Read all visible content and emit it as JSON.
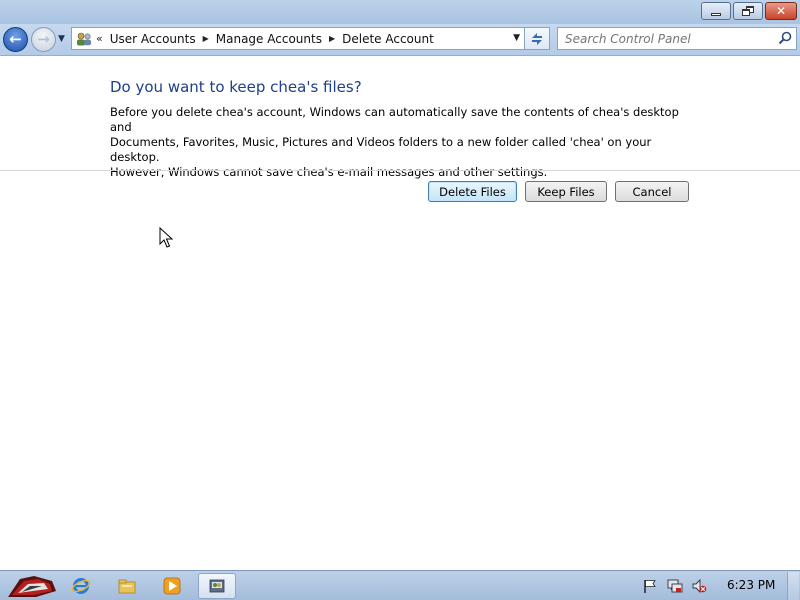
{
  "window": {
    "controls": {
      "minimize_icon": "minimize-icon",
      "maximize_icon": "restore-icon",
      "close_icon": "close-icon"
    }
  },
  "navigation": {
    "back_icon": "back-arrow-icon",
    "forward_icon": "forward-arrow-icon",
    "address_lead": "«",
    "breadcrumbs": [
      {
        "label": "User Accounts"
      },
      {
        "label": "Manage Accounts"
      },
      {
        "label": "Delete Account"
      }
    ],
    "search_placeholder": "Search Control Panel"
  },
  "main": {
    "heading": "Do you want to keep chea's files?",
    "description_lines": [
      "Before you delete chea's account, Windows can automatically save the contents of chea's desktop and",
      "Documents, Favorites, Music, Pictures and Videos folders to a new folder called 'chea' on your desktop.",
      "However, Windows cannot save chea's e-mail messages and other settings."
    ],
    "buttons": {
      "delete_files": "Delete Files",
      "keep_files": "Keep Files",
      "cancel": "Cancel"
    }
  },
  "taskbar": {
    "items": [
      "start-orb-icon",
      "internet-explorer-icon",
      "windows-explorer-icon",
      "media-player-icon",
      "control-panel-icon"
    ],
    "tray": [
      "action-center-flag-icon",
      "network-icon",
      "volume-muted-icon"
    ],
    "clock": "6:23 PM"
  },
  "colors": {
    "heading": "#1e3f8b",
    "titlebar": "#bcd2ea",
    "taskbar": "#a4bcdb"
  }
}
